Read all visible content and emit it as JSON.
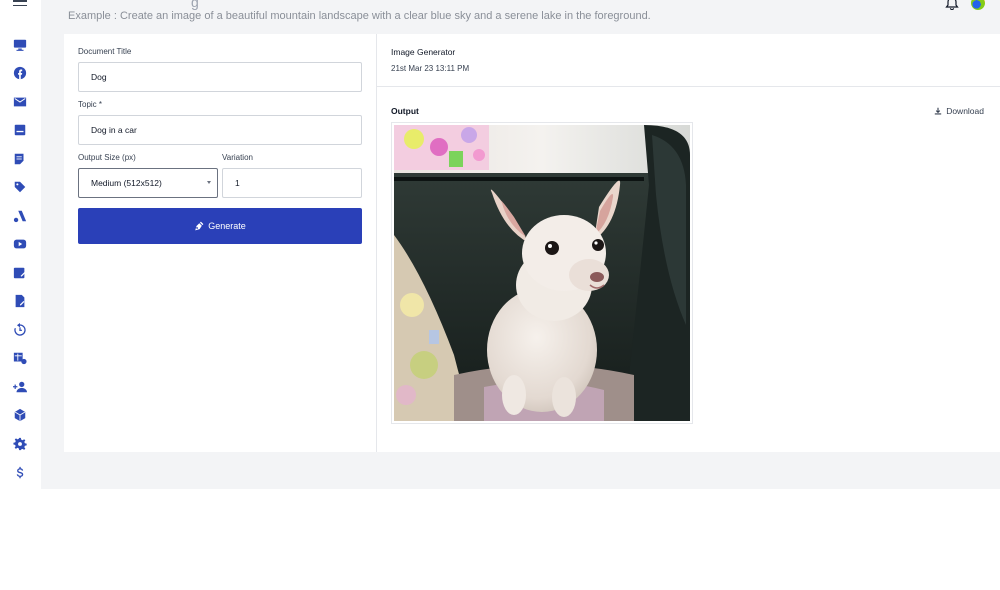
{
  "header": {
    "subtitle": "Example : Create an image of a beautiful mountain landscape with a clear blue sky and a serene lake in the foreground."
  },
  "sidebar": {
    "icons": [
      "monitor-icon",
      "facebook-icon",
      "email-icon",
      "layout-icon",
      "document-icon",
      "tag-icon",
      "google-ads-icon",
      "youtube-icon",
      "edit-note-icon",
      "file-edit-icon",
      "history-icon",
      "table-settings-icon",
      "add-user-icon",
      "package-icon",
      "gear-icon",
      "dollar-icon"
    ]
  },
  "form": {
    "document_title_label": "Document Title",
    "document_title_value": "Dog",
    "topic_label": "Topic *",
    "topic_value": "Dog in a car",
    "output_size_label": "Output Size (px)",
    "output_size_value": "Medium (512x512)",
    "variation_label": "Variation",
    "variation_value": "1",
    "generate_label": "Generate"
  },
  "output": {
    "tool_name": "Image Generator",
    "timestamp": "21st Mar 23 13:11 PM",
    "label": "Output",
    "download_label": "Download"
  },
  "colors": {
    "accent": "#2a40b8",
    "icon": "#2f4cb6",
    "background": "#f3f4f6"
  }
}
